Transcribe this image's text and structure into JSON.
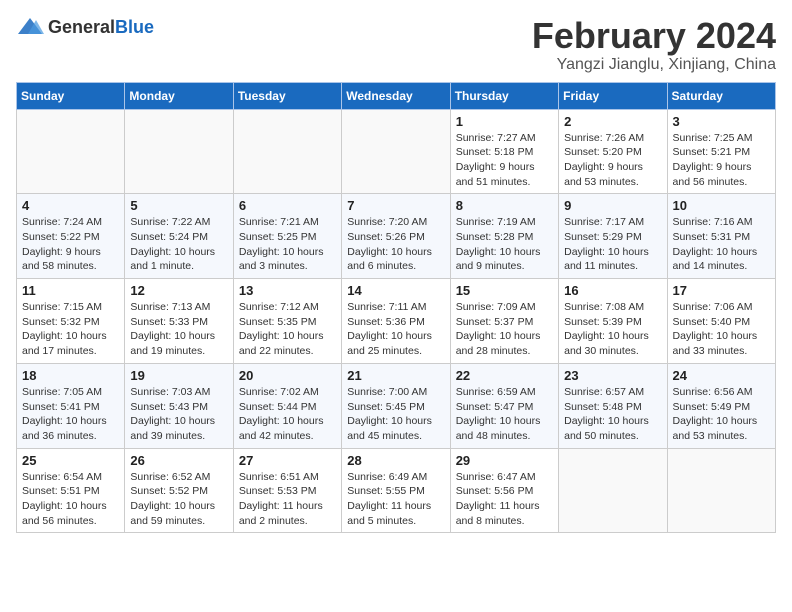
{
  "logo": {
    "text_general": "General",
    "text_blue": "Blue"
  },
  "title": "February 2024",
  "location": "Yangzi Jianglu, Xinjiang, China",
  "weekdays": [
    "Sunday",
    "Monday",
    "Tuesday",
    "Wednesday",
    "Thursday",
    "Friday",
    "Saturday"
  ],
  "weeks": [
    [
      {
        "day": "",
        "info": ""
      },
      {
        "day": "",
        "info": ""
      },
      {
        "day": "",
        "info": ""
      },
      {
        "day": "",
        "info": ""
      },
      {
        "day": "1",
        "info": "Sunrise: 7:27 AM\nSunset: 5:18 PM\nDaylight: 9 hours and 51 minutes."
      },
      {
        "day": "2",
        "info": "Sunrise: 7:26 AM\nSunset: 5:20 PM\nDaylight: 9 hours and 53 minutes."
      },
      {
        "day": "3",
        "info": "Sunrise: 7:25 AM\nSunset: 5:21 PM\nDaylight: 9 hours and 56 minutes."
      }
    ],
    [
      {
        "day": "4",
        "info": "Sunrise: 7:24 AM\nSunset: 5:22 PM\nDaylight: 9 hours and 58 minutes."
      },
      {
        "day": "5",
        "info": "Sunrise: 7:22 AM\nSunset: 5:24 PM\nDaylight: 10 hours and 1 minute."
      },
      {
        "day": "6",
        "info": "Sunrise: 7:21 AM\nSunset: 5:25 PM\nDaylight: 10 hours and 3 minutes."
      },
      {
        "day": "7",
        "info": "Sunrise: 7:20 AM\nSunset: 5:26 PM\nDaylight: 10 hours and 6 minutes."
      },
      {
        "day": "8",
        "info": "Sunrise: 7:19 AM\nSunset: 5:28 PM\nDaylight: 10 hours and 9 minutes."
      },
      {
        "day": "9",
        "info": "Sunrise: 7:17 AM\nSunset: 5:29 PM\nDaylight: 10 hours and 11 minutes."
      },
      {
        "day": "10",
        "info": "Sunrise: 7:16 AM\nSunset: 5:31 PM\nDaylight: 10 hours and 14 minutes."
      }
    ],
    [
      {
        "day": "11",
        "info": "Sunrise: 7:15 AM\nSunset: 5:32 PM\nDaylight: 10 hours and 17 minutes."
      },
      {
        "day": "12",
        "info": "Sunrise: 7:13 AM\nSunset: 5:33 PM\nDaylight: 10 hours and 19 minutes."
      },
      {
        "day": "13",
        "info": "Sunrise: 7:12 AM\nSunset: 5:35 PM\nDaylight: 10 hours and 22 minutes."
      },
      {
        "day": "14",
        "info": "Sunrise: 7:11 AM\nSunset: 5:36 PM\nDaylight: 10 hours and 25 minutes."
      },
      {
        "day": "15",
        "info": "Sunrise: 7:09 AM\nSunset: 5:37 PM\nDaylight: 10 hours and 28 minutes."
      },
      {
        "day": "16",
        "info": "Sunrise: 7:08 AM\nSunset: 5:39 PM\nDaylight: 10 hours and 30 minutes."
      },
      {
        "day": "17",
        "info": "Sunrise: 7:06 AM\nSunset: 5:40 PM\nDaylight: 10 hours and 33 minutes."
      }
    ],
    [
      {
        "day": "18",
        "info": "Sunrise: 7:05 AM\nSunset: 5:41 PM\nDaylight: 10 hours and 36 minutes."
      },
      {
        "day": "19",
        "info": "Sunrise: 7:03 AM\nSunset: 5:43 PM\nDaylight: 10 hours and 39 minutes."
      },
      {
        "day": "20",
        "info": "Sunrise: 7:02 AM\nSunset: 5:44 PM\nDaylight: 10 hours and 42 minutes."
      },
      {
        "day": "21",
        "info": "Sunrise: 7:00 AM\nSunset: 5:45 PM\nDaylight: 10 hours and 45 minutes."
      },
      {
        "day": "22",
        "info": "Sunrise: 6:59 AM\nSunset: 5:47 PM\nDaylight: 10 hours and 48 minutes."
      },
      {
        "day": "23",
        "info": "Sunrise: 6:57 AM\nSunset: 5:48 PM\nDaylight: 10 hours and 50 minutes."
      },
      {
        "day": "24",
        "info": "Sunrise: 6:56 AM\nSunset: 5:49 PM\nDaylight: 10 hours and 53 minutes."
      }
    ],
    [
      {
        "day": "25",
        "info": "Sunrise: 6:54 AM\nSunset: 5:51 PM\nDaylight: 10 hours and 56 minutes."
      },
      {
        "day": "26",
        "info": "Sunrise: 6:52 AM\nSunset: 5:52 PM\nDaylight: 10 hours and 59 minutes."
      },
      {
        "day": "27",
        "info": "Sunrise: 6:51 AM\nSunset: 5:53 PM\nDaylight: 11 hours and 2 minutes."
      },
      {
        "day": "28",
        "info": "Sunrise: 6:49 AM\nSunset: 5:55 PM\nDaylight: 11 hours and 5 minutes."
      },
      {
        "day": "29",
        "info": "Sunrise: 6:47 AM\nSunset: 5:56 PM\nDaylight: 11 hours and 8 minutes."
      },
      {
        "day": "",
        "info": ""
      },
      {
        "day": "",
        "info": ""
      }
    ]
  ]
}
